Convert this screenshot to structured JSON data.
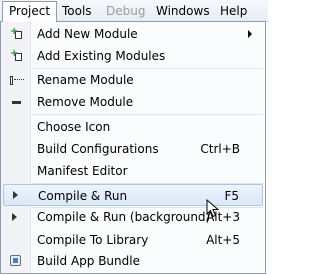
{
  "menubar": {
    "items": [
      {
        "label": "Project",
        "state": "active"
      },
      {
        "label": "Tools",
        "state": "normal"
      },
      {
        "label": "Debug",
        "state": "disabled"
      },
      {
        "label": "Windows",
        "state": "normal"
      },
      {
        "label": "Help",
        "state": "normal"
      }
    ]
  },
  "menu": {
    "items": [
      {
        "label": "Add New Module",
        "icon": "add-new-module-icon",
        "submenu": true
      },
      {
        "label": "Add Existing Modules",
        "icon": "add-existing-modules-icon"
      },
      {
        "label": "Rename Module",
        "icon": "rename-icon"
      },
      {
        "label": "Remove Module",
        "icon": "remove-icon"
      },
      {
        "label": "Choose Icon"
      },
      {
        "label": "Build Configurations",
        "shortcut": "Ctrl+B"
      },
      {
        "label": "Manifest Editor"
      },
      {
        "label": "Compile & Run",
        "shortcut": "F5",
        "icon": "play-icon",
        "highlighted": true
      },
      {
        "label": "Compile & Run (background)",
        "shortcut": "Alt+3",
        "icon": "play-icon"
      },
      {
        "label": "Compile To Library",
        "shortcut": "Alt+5"
      },
      {
        "label": "Build App Bundle",
        "icon": "bundle-icon"
      }
    ]
  },
  "colors": {
    "menubar_bg": "#e7ecf3",
    "menu_bg": "#fbfcfe",
    "highlight_bg": "#dbe8f8",
    "highlight_border": "#aec6e6",
    "disabled_text": "#9a9a9a"
  }
}
